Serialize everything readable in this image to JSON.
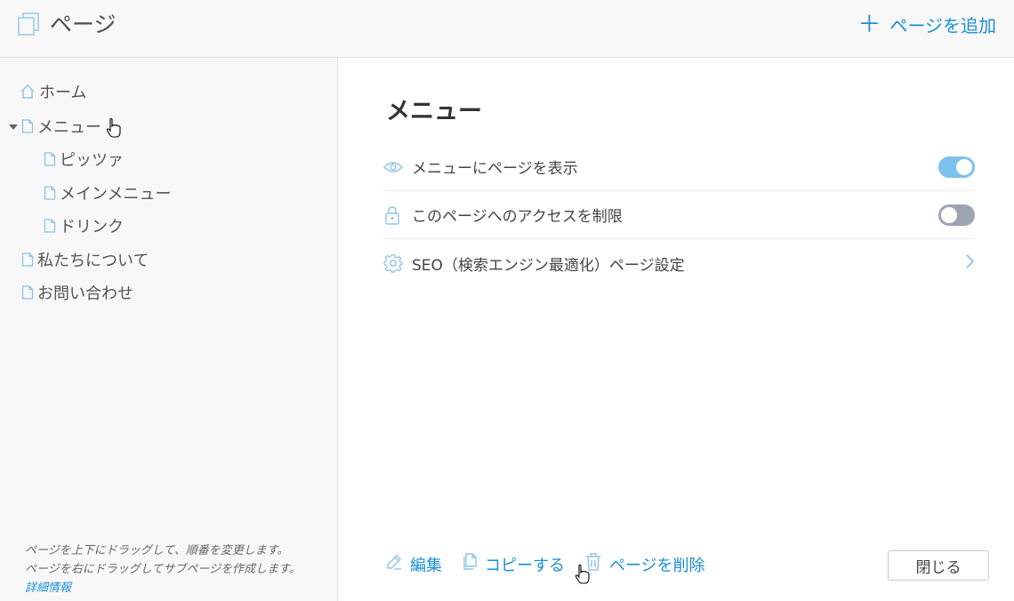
{
  "header": {
    "title": "ページ",
    "add_page_label": "ページを追加"
  },
  "sidebar": {
    "items": [
      {
        "label": "ホーム",
        "icon": "home-icon"
      },
      {
        "label": "メニュー",
        "icon": "page-icon",
        "expanded": true
      },
      {
        "label": "ピッツァ",
        "icon": "page-icon"
      },
      {
        "label": "メインメニュー",
        "icon": "page-icon"
      },
      {
        "label": "ドリンク",
        "icon": "page-icon"
      },
      {
        "label": "私たちについて",
        "icon": "page-icon"
      },
      {
        "label": "お問い合わせ",
        "icon": "page-icon"
      }
    ],
    "hint_line1": "ページを上下にドラッグして、順番を変更します。",
    "hint_line2": "ページを右にドラッグしてサブページを作成します。",
    "hint_link": "詳細情報"
  },
  "main": {
    "title": "メニュー",
    "settings": [
      {
        "label": "メニューにページを表示",
        "icon": "eye-icon",
        "toggle": true
      },
      {
        "label": "このページへのアクセスを制限",
        "icon": "lock-icon",
        "toggle": false
      },
      {
        "label": "SEO（検索エンジン最適化）ページ設定",
        "icon": "gear-icon"
      }
    ],
    "actions": {
      "edit": "編集",
      "copy": "コピーする",
      "delete": "ページを削除",
      "close": "閉じる"
    }
  },
  "colors": {
    "accent": "#1a8fd6",
    "toggle_on": "#7cc2ec",
    "toggle_off": "#9ea5b0"
  }
}
